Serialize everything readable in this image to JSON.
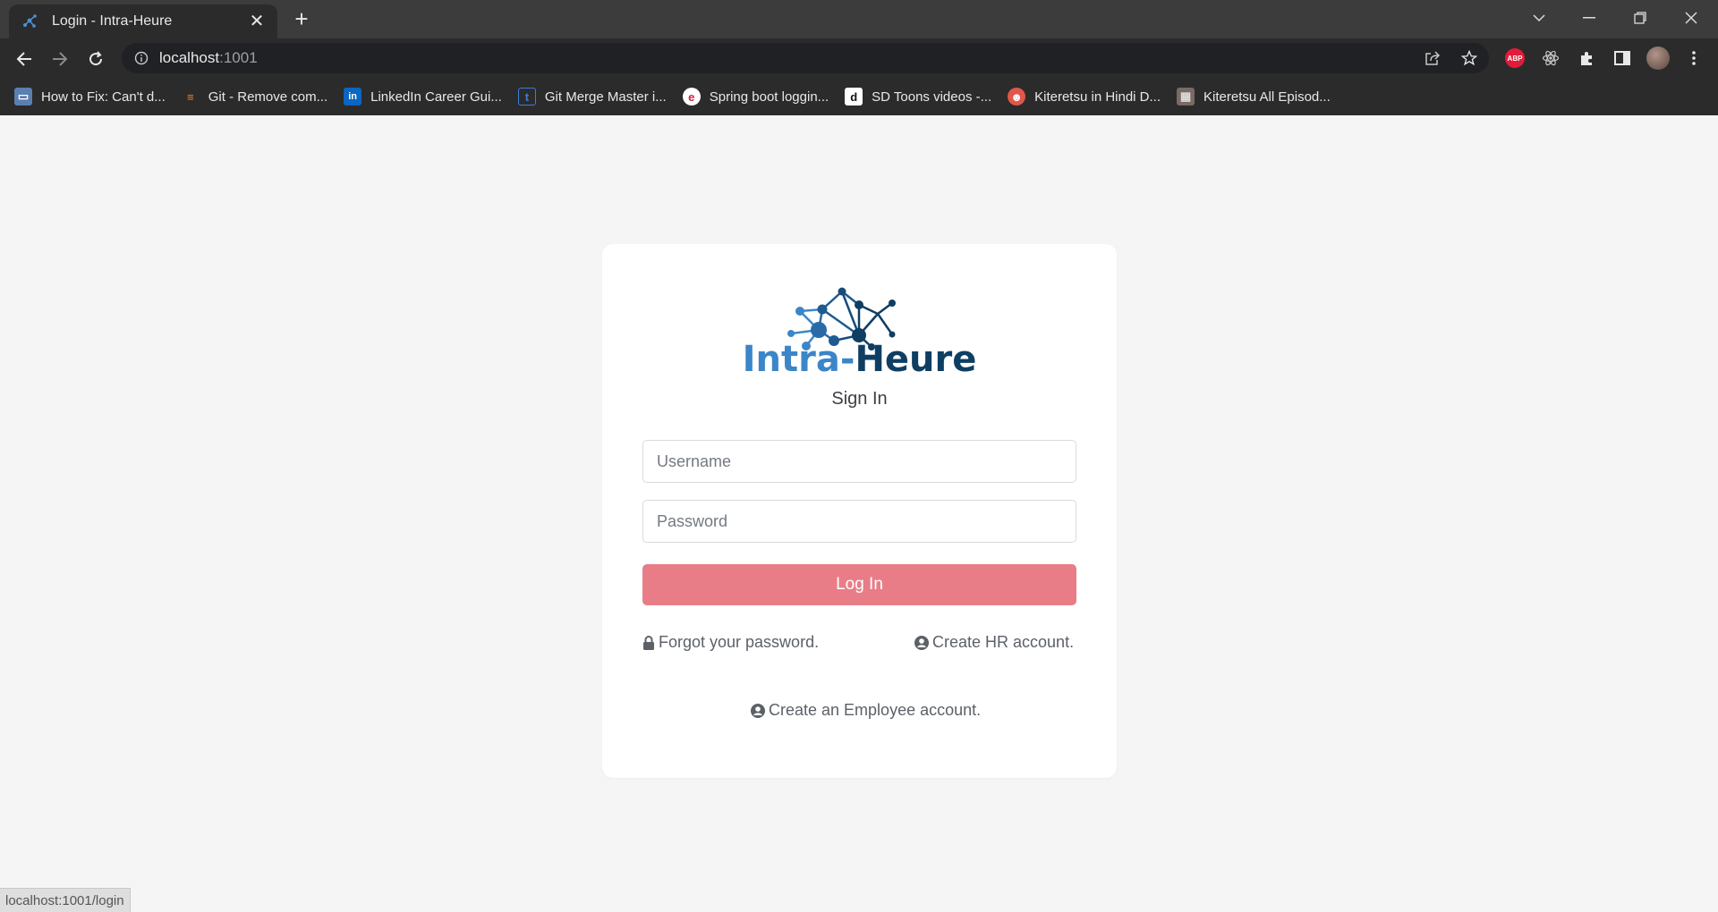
{
  "browser": {
    "tab": {
      "title": "Login - Intra-Heure"
    },
    "address": {
      "host": "localhost",
      "port": ":1001"
    },
    "bookmarks": [
      {
        "label": "How to Fix: Can't d...",
        "icon": "laptop-icon"
      },
      {
        "label": "Git - Remove com...",
        "icon": "stackoverflow-icon"
      },
      {
        "label": "LinkedIn Career Gui...",
        "icon": "linkedin-icon"
      },
      {
        "label": "Git Merge Master i...",
        "icon": "t-icon"
      },
      {
        "label": "Spring boot loggin...",
        "icon": "e-icon"
      },
      {
        "label": "SD Toons videos -...",
        "icon": "d-icon"
      },
      {
        "label": "Kiteretsu in Hindi D...",
        "icon": "character-icon"
      },
      {
        "label": "Kiteretsu All Episod...",
        "icon": "pattern-icon"
      }
    ],
    "extensions": {
      "abp_label": "ABP"
    },
    "status_url": "localhost:1001/login"
  },
  "login": {
    "brand_part1": "Intra-",
    "brand_part2": "Heure",
    "heading": "Sign In",
    "username_placeholder": "Username",
    "password_placeholder": "Password",
    "login_button": "Log In",
    "forgot_password": "Forgot your password.",
    "create_hr": "Create HR account.",
    "create_employee": "Create an Employee account."
  },
  "colors": {
    "accent_button": "#e87d87",
    "brand_light": "#3b86c8",
    "brand_dark": "#0f3e63"
  }
}
